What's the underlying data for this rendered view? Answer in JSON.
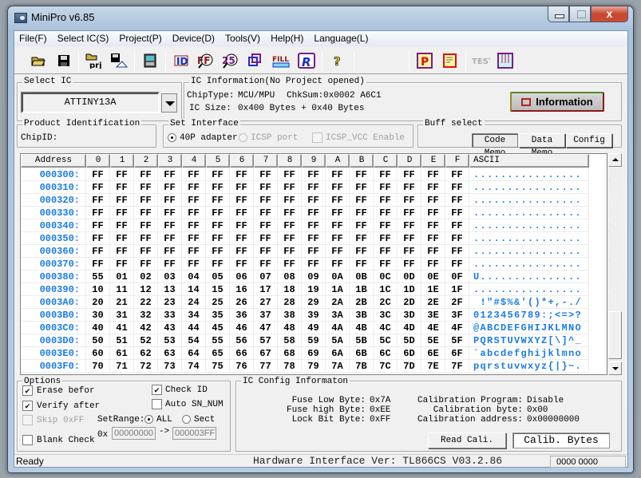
{
  "window": {
    "title": "MiniPro v6.85"
  },
  "menu": [
    "File(F)",
    "Select IC(S)",
    "Project(P)",
    "Device(D)",
    "Tools(V)",
    "Help(H)",
    "Language(L)"
  ],
  "toolbar": {
    "icons": [
      "open-file-icon",
      "save-file-icon",
      "open-project-icon",
      "save-project-icon",
      "device-icon",
      "read-id-icon",
      "blank-check-icon",
      "verify-icon",
      "read-icon",
      "fill-icon",
      "read-chip-icon",
      "help-icon",
      "program-icon",
      "edit-config-icon",
      "test-icon",
      "erase-icon"
    ]
  },
  "select_ic": {
    "legend": "Select IC",
    "value": "ATTINY13A"
  },
  "ic_info": {
    "legend": "IC Information(No Project opened)",
    "chiptype_label": "ChipType:",
    "chiptype_value": "MCU/MPU",
    "chksum_label": "ChkSum:",
    "chksum_value": "0x0002 A6C1",
    "size_label": "IC Size:",
    "size_value": "0x400 Bytes + 0x40 Bytes",
    "information_button": "Information"
  },
  "product_id": {
    "legend": "Product Identification",
    "chipid_label": "ChipID:"
  },
  "interface": {
    "legend": "Set Interface",
    "options": [
      "40P adapter",
      "ICSP port"
    ],
    "selected": "40P adapter",
    "icsp_vcc_label": "ICSP_VCC Enable",
    "icsp_vcc_checked": false
  },
  "buff_select": {
    "legend": "Buff select",
    "tabs": [
      "Code Memo",
      "Data Memo",
      "Config"
    ],
    "active": "Code Memo"
  },
  "grid": {
    "headers": [
      "Address",
      "0",
      "1",
      "2",
      "3",
      "4",
      "5",
      "6",
      "7",
      "8",
      "9",
      "A",
      "B",
      "C",
      "D",
      "E",
      "F",
      "ASCII"
    ],
    "rows": [
      {
        "addr": "000300:",
        "bytes": [
          "FF",
          "FF",
          "FF",
          "FF",
          "FF",
          "FF",
          "FF",
          "FF",
          "FF",
          "FF",
          "FF",
          "FF",
          "FF",
          "FF",
          "FF",
          "FF"
        ],
        "ascii": "................"
      },
      {
        "addr": "000310:",
        "bytes": [
          "FF",
          "FF",
          "FF",
          "FF",
          "FF",
          "FF",
          "FF",
          "FF",
          "FF",
          "FF",
          "FF",
          "FF",
          "FF",
          "FF",
          "FF",
          "FF"
        ],
        "ascii": "................"
      },
      {
        "addr": "000320:",
        "bytes": [
          "FF",
          "FF",
          "FF",
          "FF",
          "FF",
          "FF",
          "FF",
          "FF",
          "FF",
          "FF",
          "FF",
          "FF",
          "FF",
          "FF",
          "FF",
          "FF"
        ],
        "ascii": "................"
      },
      {
        "addr": "000330:",
        "bytes": [
          "FF",
          "FF",
          "FF",
          "FF",
          "FF",
          "FF",
          "FF",
          "FF",
          "FF",
          "FF",
          "FF",
          "FF",
          "FF",
          "FF",
          "FF",
          "FF"
        ],
        "ascii": "................"
      },
      {
        "addr": "000340:",
        "bytes": [
          "FF",
          "FF",
          "FF",
          "FF",
          "FF",
          "FF",
          "FF",
          "FF",
          "FF",
          "FF",
          "FF",
          "FF",
          "FF",
          "FF",
          "FF",
          "FF"
        ],
        "ascii": "................"
      },
      {
        "addr": "000350:",
        "bytes": [
          "FF",
          "FF",
          "FF",
          "FF",
          "FF",
          "FF",
          "FF",
          "FF",
          "FF",
          "FF",
          "FF",
          "FF",
          "FF",
          "FF",
          "FF",
          "FF"
        ],
        "ascii": "................"
      },
      {
        "addr": "000360:",
        "bytes": [
          "FF",
          "FF",
          "FF",
          "FF",
          "FF",
          "FF",
          "FF",
          "FF",
          "FF",
          "FF",
          "FF",
          "FF",
          "FF",
          "FF",
          "FF",
          "FF"
        ],
        "ascii": "................"
      },
      {
        "addr": "000370:",
        "bytes": [
          "FF",
          "FF",
          "FF",
          "FF",
          "FF",
          "FF",
          "FF",
          "FF",
          "FF",
          "FF",
          "FF",
          "FF",
          "FF",
          "FF",
          "FF",
          "FF"
        ],
        "ascii": "................"
      },
      {
        "addr": "000380:",
        "bytes": [
          "55",
          "01",
          "02",
          "03",
          "04",
          "05",
          "06",
          "07",
          "08",
          "09",
          "0A",
          "0B",
          "0C",
          "0D",
          "0E",
          "0F"
        ],
        "ascii": "U..............."
      },
      {
        "addr": "000390:",
        "bytes": [
          "10",
          "11",
          "12",
          "13",
          "14",
          "15",
          "16",
          "17",
          "18",
          "19",
          "1A",
          "1B",
          "1C",
          "1D",
          "1E",
          "1F"
        ],
        "ascii": "................"
      },
      {
        "addr": "0003A0:",
        "bytes": [
          "20",
          "21",
          "22",
          "23",
          "24",
          "25",
          "26",
          "27",
          "28",
          "29",
          "2A",
          "2B",
          "2C",
          "2D",
          "2E",
          "2F"
        ],
        "ascii": " !\"#$%&'()*+,-./"
      },
      {
        "addr": "0003B0:",
        "bytes": [
          "30",
          "31",
          "32",
          "33",
          "34",
          "35",
          "36",
          "37",
          "38",
          "39",
          "3A",
          "3B",
          "3C",
          "3D",
          "3E",
          "3F"
        ],
        "ascii": "0123456789:;<=>?"
      },
      {
        "addr": "0003C0:",
        "bytes": [
          "40",
          "41",
          "42",
          "43",
          "44",
          "45",
          "46",
          "47",
          "48",
          "49",
          "4A",
          "4B",
          "4C",
          "4D",
          "4E",
          "4F"
        ],
        "ascii": "@ABCDEFGHIJKLMNO"
      },
      {
        "addr": "0003D0:",
        "bytes": [
          "50",
          "51",
          "52",
          "53",
          "54",
          "55",
          "56",
          "57",
          "58",
          "59",
          "5A",
          "5B",
          "5C",
          "5D",
          "5E",
          "5F"
        ],
        "ascii": "PQRSTUVWXYZ[\\]^_"
      },
      {
        "addr": "0003E0:",
        "bytes": [
          "60",
          "61",
          "62",
          "63",
          "64",
          "65",
          "66",
          "67",
          "68",
          "69",
          "6A",
          "6B",
          "6C",
          "6D",
          "6E",
          "6F"
        ],
        "ascii": "`abcdefghijklmno"
      },
      {
        "addr": "0003F0:",
        "bytes": [
          "70",
          "71",
          "72",
          "73",
          "74",
          "75",
          "76",
          "77",
          "78",
          "79",
          "7A",
          "7B",
          "7C",
          "7D",
          "7E",
          "7F"
        ],
        "ascii": "pqrstuvwxyz{|}~."
      }
    ]
  },
  "options": {
    "legend": "Options",
    "erase_before": {
      "label": "Erase befor",
      "checked": true
    },
    "verify_after": {
      "label": "Verify after",
      "checked": true
    },
    "skip_ff": {
      "label": "Skip 0xFF",
      "checked": false,
      "disabled": true
    },
    "blank_check": {
      "label": "Blank Check",
      "checked": false
    },
    "check_id": {
      "label": "Check ID",
      "checked": true
    },
    "auto_sn": {
      "label": "Auto SN_NUM",
      "checked": false
    },
    "setrange_label": "SetRange:",
    "range_options": [
      "ALL",
      "Sect"
    ],
    "range_selected": "ALL",
    "ox_label": "0x",
    "range_start": "00000000",
    "arrow": "->",
    "range_end": "000003FF"
  },
  "config_info": {
    "legend": "IC Config Informaton",
    "fuse_low_label": "Fuse Low Byte:",
    "fuse_low_value": "0x7A",
    "fuse_high_label": "Fuse high Byte:",
    "fuse_high_value": "0xEE",
    "lock_label": "Lock Bit Byte:",
    "lock_value": "0xFF",
    "cal_prog_label": "Calibration Program:",
    "cal_prog_value": "Disable",
    "cal_byte_label": "Calibration byte:",
    "cal_byte_value": "0x00",
    "cal_addr_label": "Calibration address:",
    "cal_addr_value": "0x00000000",
    "read_cali_button": "Read Cali.",
    "calib_bytes_button": "Calib. Bytes"
  },
  "status": {
    "text": "Ready",
    "hardware": "Hardware Interface Ver: TL866CS V03.2.86",
    "counter": "0000 0000"
  }
}
